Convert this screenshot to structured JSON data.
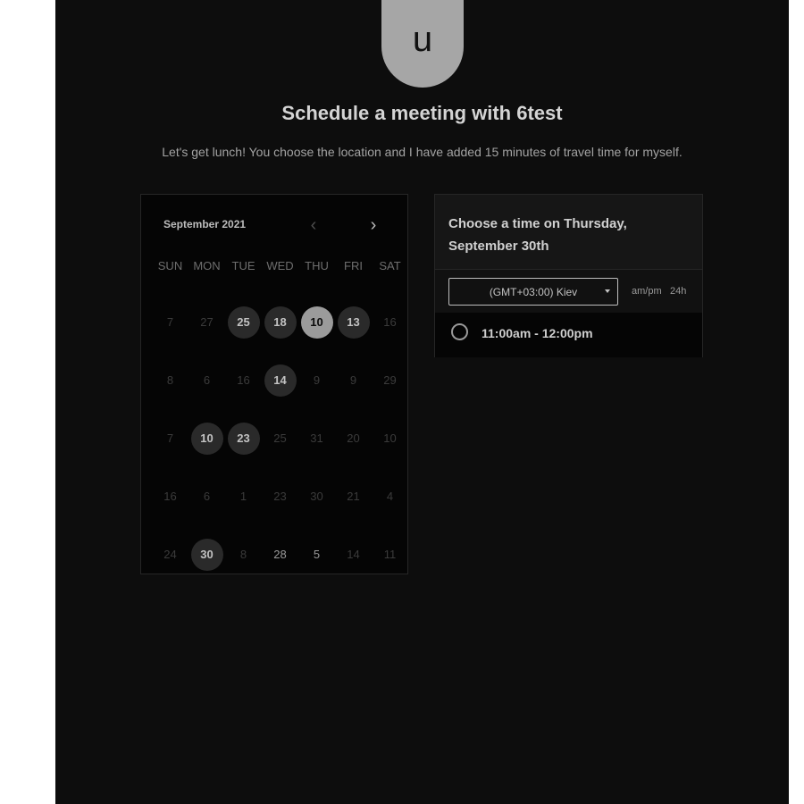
{
  "host": {
    "avatar_letter": "u",
    "title": "Schedule a meeting with 6test",
    "description": "Let's get lunch! You choose the location and I have added 15 minutes of travel time for myself."
  },
  "calendar": {
    "month_label": "September 2021",
    "weekdays": [
      "SUN",
      "MON",
      "TUE",
      "WED",
      "THU",
      "FRI",
      "SAT"
    ],
    "weeks": [
      [
        "7",
        "27",
        "25",
        "18",
        "10",
        "13",
        "16"
      ],
      [
        "8",
        "6",
        "16",
        "14",
        "9",
        "9",
        "29"
      ],
      [
        "7",
        "10",
        "23",
        "25",
        "31",
        "20",
        "10"
      ],
      [
        "16",
        "6",
        "1",
        "23",
        "30",
        "21",
        "4"
      ],
      [
        "24",
        "30",
        "8",
        "28",
        "5",
        "14",
        "11"
      ]
    ]
  },
  "times": {
    "heading": "Choose a time on Thursday, September 30th",
    "timezone": "(GMT+03:00) Kiev",
    "format_ampm": "am/pm",
    "format_24h": "24h",
    "slots": [
      "11:00am - 12:00pm"
    ]
  },
  "colors": {
    "background": "#0d0d0d",
    "available_day": "#2a2a2a",
    "selected_day": "#9b9b9b"
  }
}
